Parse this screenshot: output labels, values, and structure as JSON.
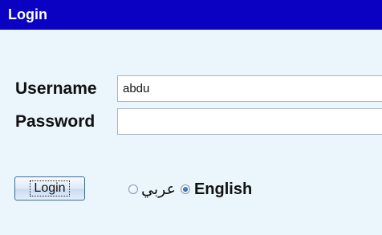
{
  "dialog": {
    "title": "Login"
  },
  "form": {
    "username_label": "Username",
    "username_value": "abdu",
    "password_label": "Password",
    "password_value": ""
  },
  "actions": {
    "login_label": "Login"
  },
  "language": {
    "options": [
      {
        "label": "عربي",
        "selected": false
      },
      {
        "label": "English",
        "selected": true
      }
    ]
  },
  "colors": {
    "title_bar": "#0a01c3",
    "panel_background": "#eaf6fc"
  }
}
